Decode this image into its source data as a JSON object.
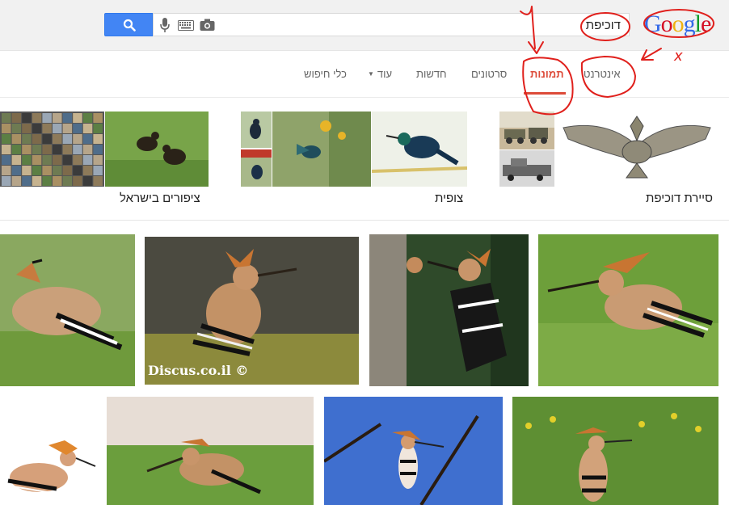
{
  "search": {
    "query": "דוכיפת"
  },
  "logo": {
    "letters": [
      "G",
      "o",
      "o",
      "g",
      "l",
      "e"
    ],
    "colors": [
      "#3369e8",
      "#d50f25",
      "#eeb211",
      "#3369e8",
      "#009925",
      "#d50f25"
    ]
  },
  "tabs": {
    "web": "אינטרנט",
    "images": "תמונות",
    "videos": "סרטונים",
    "news": "חדשות",
    "more": "עוד",
    "tools": "כלי חיפוש"
  },
  "related": {
    "group1": "סיירת דוכיפת",
    "group2": "צופית",
    "group3": "ציפורים בישראל"
  },
  "watermark": "Discus.co.il ©",
  "annotations": {
    "x_mark": "x"
  },
  "colors": {
    "accent": "#dd4b39",
    "search_blue": "#4285f4",
    "annotation_red": "#e0201c"
  }
}
